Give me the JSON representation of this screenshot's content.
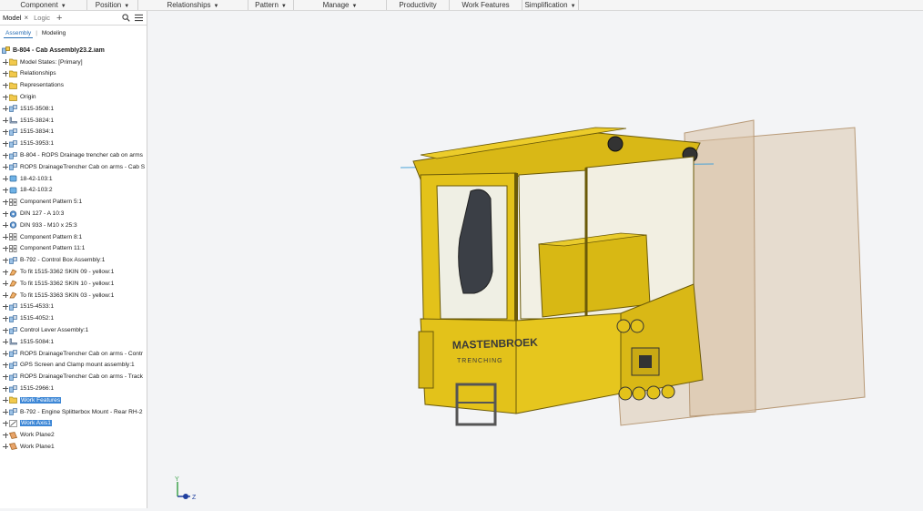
{
  "ribbon": {
    "items": [
      {
        "label": "Component",
        "has_arrow": true
      },
      {
        "label": "Position",
        "has_arrow": true
      },
      {
        "label": "Relationships",
        "has_arrow": true
      },
      {
        "label": "Pattern",
        "has_arrow": true
      },
      {
        "label": "Manage",
        "has_arrow": true
      },
      {
        "label": "Productivity",
        "has_arrow": false
      },
      {
        "label": "Work Features",
        "has_arrow": false
      },
      {
        "label": "Simplification",
        "has_arrow": true
      }
    ]
  },
  "panel": {
    "tab_model": "Model",
    "tab_close": "×",
    "tab_logic": "Logic",
    "tab_add": "+",
    "subtab_assembly": "Assembly",
    "subtab_modeling": "Modeling"
  },
  "tree": {
    "root": "B-804 - Cab Assembly23.2.iam",
    "rows": [
      {
        "label": "Model States: [Primary]",
        "icon": "folder-icon"
      },
      {
        "label": "Relationships",
        "icon": "folder-icon"
      },
      {
        "label": "Representations",
        "icon": "folder-icon"
      },
      {
        "label": "Origin",
        "icon": "folder-icon"
      },
      {
        "label": "1515-3508:1",
        "icon": "assembly-icon"
      },
      {
        "label": "1515-3824:1",
        "icon": "sheetmetal-icon"
      },
      {
        "label": "1515-3834:1",
        "icon": "assembly-icon"
      },
      {
        "label": "1515-3953:1",
        "icon": "assembly-icon"
      },
      {
        "label": "B-804 - ROPS Drainage trencher cab on arms",
        "icon": "assembly-icon"
      },
      {
        "label": "ROPS DrainageTrencher Cab on arms - Cab S",
        "icon": "assembly-icon"
      },
      {
        "label": "18-42-103:1",
        "icon": "part-icon"
      },
      {
        "label": "18-42-103:2",
        "icon": "part-icon"
      },
      {
        "label": "Component Pattern 5:1",
        "icon": "pattern-icon"
      },
      {
        "label": "DIN 127 - A 10:3",
        "icon": "washer-icon"
      },
      {
        "label": "DIN 933 - M10  x 25:3",
        "icon": "bolt-icon"
      },
      {
        "label": "Component Pattern 8:1",
        "icon": "pattern-icon"
      },
      {
        "label": "Component Pattern 11:1",
        "icon": "pattern-icon"
      },
      {
        "label": "B-792 - Control Box Assembly:1",
        "icon": "assembly-icon"
      },
      {
        "label": "To fit 1515-3362 SKIN 09 - yellow:1",
        "icon": "skin-icon"
      },
      {
        "label": "To fit 1515-3362 SKIN 10 - yellow:1",
        "icon": "skin-icon"
      },
      {
        "label": "To fit 1515-3363 SKIN 03 - yellow:1",
        "icon": "skin-icon"
      },
      {
        "label": "1515-4533:1",
        "icon": "assembly-icon"
      },
      {
        "label": "1515-4052:1",
        "icon": "assembly-icon"
      },
      {
        "label": "Control Lever Assembly:1",
        "icon": "assembly-icon"
      },
      {
        "label": "1515-5084:1",
        "icon": "sheetmetal-icon"
      },
      {
        "label": "ROPS DrainageTrencher Cab on arms - Contr",
        "icon": "assembly-icon"
      },
      {
        "label": "GPS Screen and Clamp mount assembly:1",
        "icon": "assembly-icon"
      },
      {
        "label": "ROPS DrainageTrencher Cab on arms - Track",
        "icon": "assembly-icon"
      },
      {
        "label": "1515-2966:1",
        "icon": "assembly-icon"
      },
      {
        "label": "Work Features",
        "icon": "folder-icon",
        "selected": true
      },
      {
        "label": "B-792 - Engine Splitterbox Mount - Rear RH-2",
        "icon": "assembly-icon"
      },
      {
        "label": "Work Axis1",
        "icon": "workaxis-icon",
        "selected": true
      },
      {
        "label": "Work Plane2",
        "icon": "workplane-icon"
      },
      {
        "label": "Work Plane1",
        "icon": "workplane-icon"
      }
    ]
  },
  "viewport": {
    "brand_text": "MASTENBROEK",
    "brand_sub": "TRENCHING",
    "axis_y": "Y",
    "axis_z": "Z"
  },
  "colors": {
    "cab_yellow": "#e3c21a",
    "cab_shadow": "#b89a0e",
    "work_plane": "#c8aa84",
    "selection": "#3d87d6"
  }
}
